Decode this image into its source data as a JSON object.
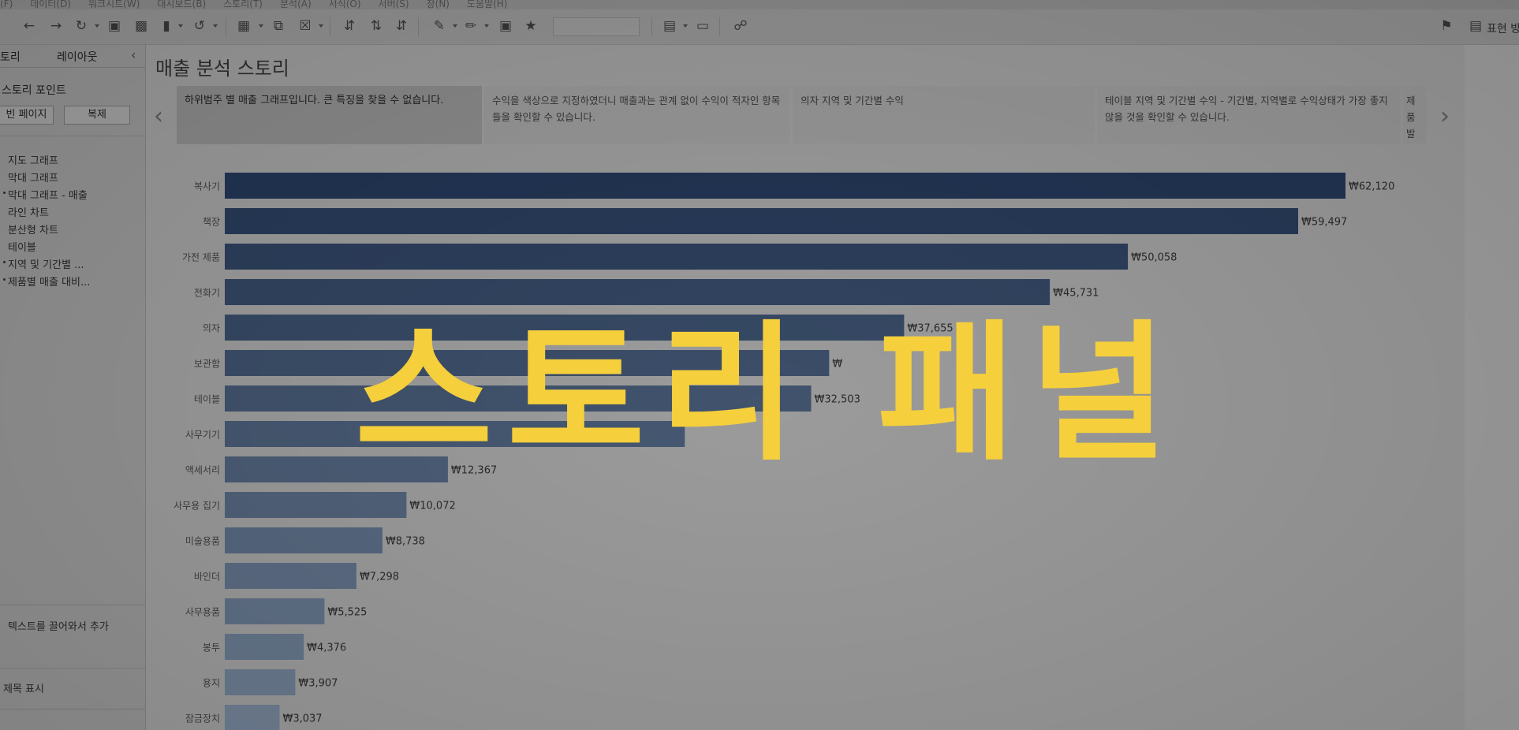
{
  "menubar": [
    "(F)",
    "데이터(D)",
    "워크시트(W)",
    "대시보드(B)",
    "스토리(T)",
    "분석(A)",
    "서식(O)",
    "서버(S)",
    "창(N)",
    "도움말(H)"
  ],
  "toolbar": {
    "right_label": "표현 방"
  },
  "sidebar": {
    "tabs": [
      "토리",
      "레이아웃"
    ],
    "heading": "스토리 포인트",
    "blank_page_label": "빈 페이지",
    "duplicate_label": "복제",
    "sheets": [
      "지도 그래프",
      "막대 그래프",
      "막대 그래프 - 매출",
      "라인 차트",
      "분산형 차트",
      "테이블",
      "지역 및 기간별 ...",
      "제품별 매출 대비..."
    ],
    "drag_text": "텍스트를 끌어와서 추가",
    "show_title": "제목 표시"
  },
  "story": {
    "title": "매출 분석 스토리",
    "points": [
      "하위범주 별 매출 그래프입니다. 큰 특징을 찾을 수 없습니다.",
      "수익을 색상으로 지정하였더니 매출과는 관계 없이 수익이 적자인 항목들을 확인할 수 있습니다.",
      "의자 지역 및 기간별 수익",
      "테이블 지역 및 기간별 수익 - 기간별, 지역별로 수익상태가 가장 좋지 않을 것을 확인할 수 있습니다.",
      "제품 발생"
    ]
  },
  "caption": "스토리 패널",
  "colors": {
    "bar_dark": "#253a5c",
    "bar_light": "#7d8fa5",
    "caption": "#f5cf3c"
  },
  "chart_data": {
    "type": "bar",
    "orientation": "horizontal",
    "categories": [
      "복사기",
      "책장",
      "가전 제품",
      "전화기",
      "의자",
      "보관함",
      "테이블",
      "사무기기",
      "액세서리",
      "사무용 집기",
      "미술용품",
      "바인더",
      "사무용품",
      "봉투",
      "용지",
      "잠금장치"
    ],
    "values": [
      62120,
      59497,
      50058,
      45731,
      37655,
      33500,
      32503,
      25500,
      12367,
      10072,
      8738,
      7298,
      5525,
      4376,
      3907,
      3037
    ],
    "labels": [
      "₩62,120",
      "₩59,497",
      "₩50,058",
      "₩45,731",
      "₩37,655",
      "₩",
      "₩32,503",
      "",
      "₩12,367",
      "₩10,072",
      "₩8,738",
      "₩7,298",
      "₩5,525",
      "₩4,376",
      "₩3,907",
      "₩3,037"
    ],
    "xlim": [
      0,
      62120
    ]
  }
}
